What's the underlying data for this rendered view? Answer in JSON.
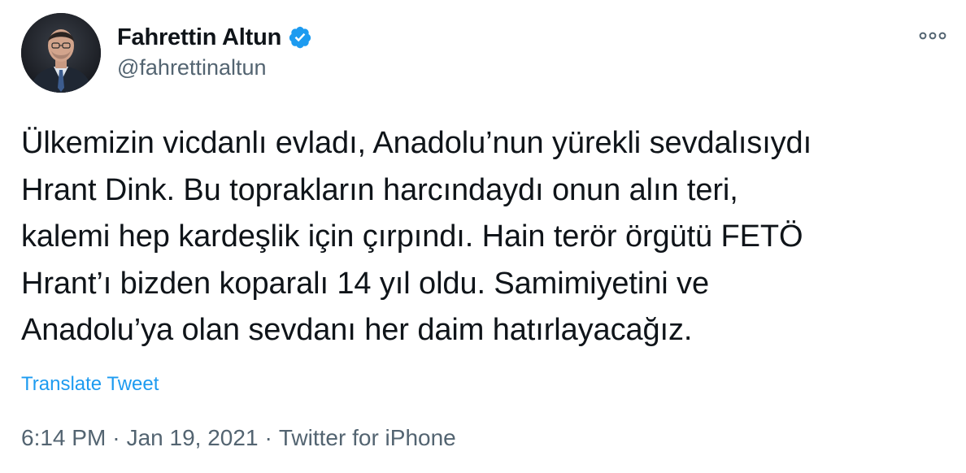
{
  "tweet": {
    "author": {
      "display_name": "Fahrettin Altun",
      "handle": "@fahrettinaltun",
      "verified": true
    },
    "text": "Ülkemizin vicdanlı evladı, Anadolu’nun yürekli sevdalısıydı\nHrant Dink. Bu toprakların harcındaydı onun alın teri,\nkalemi hep kardeşlik için çırpındı.  Hain terör örgütü FETÖ\nHrant’ı bizden koparalı 14 yıl oldu. Samimiyetini ve\nAnadolu’ya olan sevdanı her daim hatırlayacağız.",
    "translate_label": "Translate Tweet",
    "time": "6:14 PM",
    "date": "Jan 19, 2021",
    "source": "Twitter for iPhone",
    "separator": "·"
  },
  "colors": {
    "verified_badge": "#1d9bf0",
    "link": "#1d9bf0",
    "secondary_text": "#536471"
  },
  "icons": {
    "verified": "verified-badge-icon",
    "more": "more-options-icon"
  }
}
